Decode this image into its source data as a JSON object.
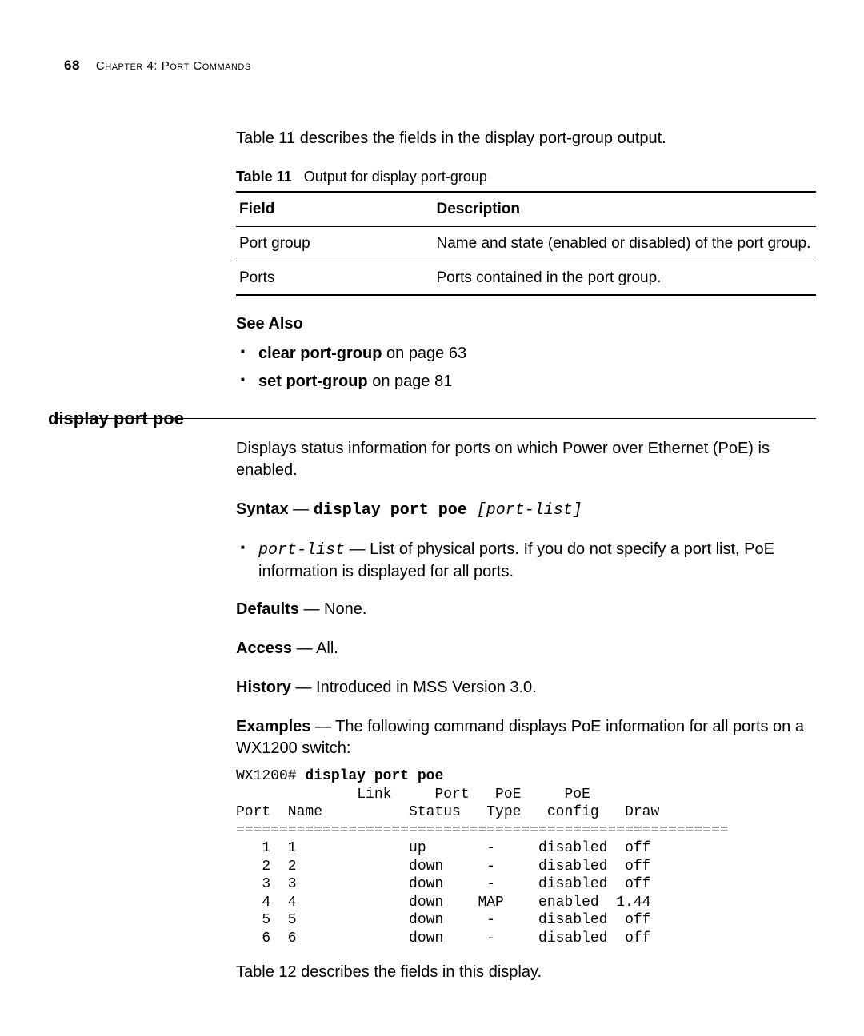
{
  "header": {
    "page_number": "68",
    "chapter": "Chapter 4: Port Commands"
  },
  "intro_para": "Table 11 describes the fields in the display port-group output.",
  "table11": {
    "caption_label": "Table 11",
    "caption_text": "Output for display port-group",
    "head_field": "Field",
    "head_desc": "Description",
    "rows": [
      {
        "field": "Port group",
        "desc": "Name and state (enabled or disabled) of the port group."
      },
      {
        "field": "Ports",
        "desc": "Ports contained in the port group."
      }
    ]
  },
  "see_also": {
    "heading": "See Also",
    "items": [
      {
        "bold": "clear port-group",
        "rest": " on page 63"
      },
      {
        "bold": "set port-group",
        "rest": " on page 81"
      }
    ]
  },
  "cmd_section": {
    "title": "display port poe",
    "desc": "Displays status information for ports on which Power over Ethernet (PoE) is enabled.",
    "syntax_label": "Syntax",
    "syntax_dash": " — ",
    "syntax_cmd": "display port poe ",
    "syntax_arg": "[port-list]",
    "args": [
      {
        "name": "port-list",
        "desc": " — List of physical ports. If you do not specify a port list, PoE information is displayed for all ports."
      }
    ],
    "defaults_label": "Defaults",
    "defaults_value": " — None.",
    "access_label": "Access",
    "access_value": " — All.",
    "history_label": "History",
    "history_value": " — Introduced in MSS Version 3.0.",
    "examples_label": "Examples",
    "examples_text": " — The following command displays PoE information for all ports on a WX1200 switch:",
    "cli": {
      "prompt": "WX1200# ",
      "command": "display port poe",
      "header1": "              Link     Port   PoE     PoE",
      "header2": "Port  Name          Status   Type   config   Draw",
      "sep": "=========================================================",
      "rows": [
        "   1  1             up       -     disabled  off",
        "   2  2             down     -     disabled  off",
        "   3  3             down     -     disabled  off",
        "   4  4             down    MAP    enabled  1.44",
        "   5  5             down     -     disabled  off",
        "   6  6             down     -     disabled  off"
      ]
    },
    "trailing_para": "Table 12 describes the fields in this display."
  },
  "chart_data": {
    "type": "table",
    "title": "display port poe output",
    "columns": [
      "Port",
      "Name",
      "Link Status",
      "Port Type",
      "PoE config",
      "PoE Draw"
    ],
    "rows": [
      [
        1,
        "1",
        "up",
        "-",
        "disabled",
        "off"
      ],
      [
        2,
        "2",
        "down",
        "-",
        "disabled",
        "off"
      ],
      [
        3,
        "3",
        "down",
        "-",
        "disabled",
        "off"
      ],
      [
        4,
        "4",
        "down",
        "MAP",
        "enabled",
        "1.44"
      ],
      [
        5,
        "5",
        "down",
        "-",
        "disabled",
        "off"
      ],
      [
        6,
        "6",
        "down",
        "-",
        "disabled",
        "off"
      ]
    ]
  }
}
